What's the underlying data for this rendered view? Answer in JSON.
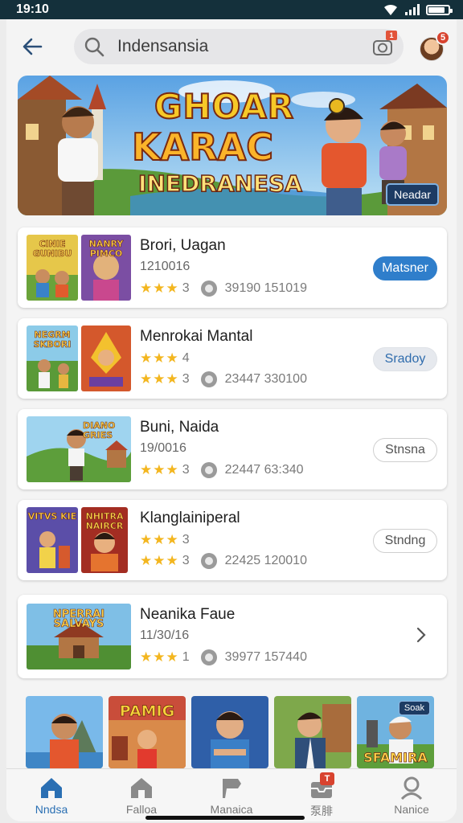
{
  "status": {
    "time": "19:10",
    "battery_level": 0.85
  },
  "header": {
    "search_value": "Indensansia",
    "camera_badge": "1",
    "avatar_badge": "5"
  },
  "banner": {
    "title_line1": "GHOAR",
    "title_line2": "KARAC",
    "subtitle": "INEDRANESA",
    "tag": "Neadar"
  },
  "cards": [
    {
      "title": "Brori, Uagan",
      "date": "1210016",
      "stars": "★★★",
      "rating": "3",
      "downloads": "39190 151019",
      "button": "Matsner",
      "thumb1": "CINIE GUNIBU",
      "thumb2": "NANRY PIMCO"
    },
    {
      "title": "Menrokai Mantal",
      "date": "",
      "stars": "★★★",
      "rating": "4",
      "stars2": "★★★",
      "rating2": "3",
      "downloads": "23447 330100",
      "button": "Sradoy",
      "thumb1": "NEGRM SKBORI",
      "thumb2": ""
    },
    {
      "title": "Buni, Naida",
      "date": "19/0016",
      "stars": "★★★",
      "rating": "3",
      "downloads": "22447 63:340",
      "button": "Stnsna",
      "thumb1": "DIANO GRIES"
    },
    {
      "title": "Klanglainiperal",
      "date": "",
      "stars": "★★★",
      "rating": "3",
      "stars2": "★★★",
      "rating2": "3",
      "downloads": "22425 120010",
      "button": "Stndng",
      "thumb1": "VITVS KIE",
      "thumb2": "NHITRA NAIRCR"
    },
    {
      "title": "Neanika Faue",
      "date": "11/30/16",
      "stars": "★★★",
      "rating": "1",
      "downloads": "39977 157440",
      "thumb1": "NPERRAI SALVAYS"
    }
  ],
  "gallery": {
    "g2_text": "PAMIG",
    "g5_tag": "Soak",
    "g5_text": "SFAMIRA"
  },
  "nav": [
    {
      "label": "Nndsa",
      "icon": "home-icon",
      "active": true
    },
    {
      "label": "Falloa",
      "icon": "store-icon"
    },
    {
      "label": "Manaica",
      "icon": "flag-icon"
    },
    {
      "label": "泵腓",
      "icon": "inbox-icon",
      "badge": "T"
    },
    {
      "label": "Nanice",
      "icon": "profile-icon"
    }
  ],
  "colors": {
    "accent": "#2f7ecb",
    "status_bar": "#14303b",
    "star": "#f3b61f",
    "badge": "#d8432f"
  }
}
